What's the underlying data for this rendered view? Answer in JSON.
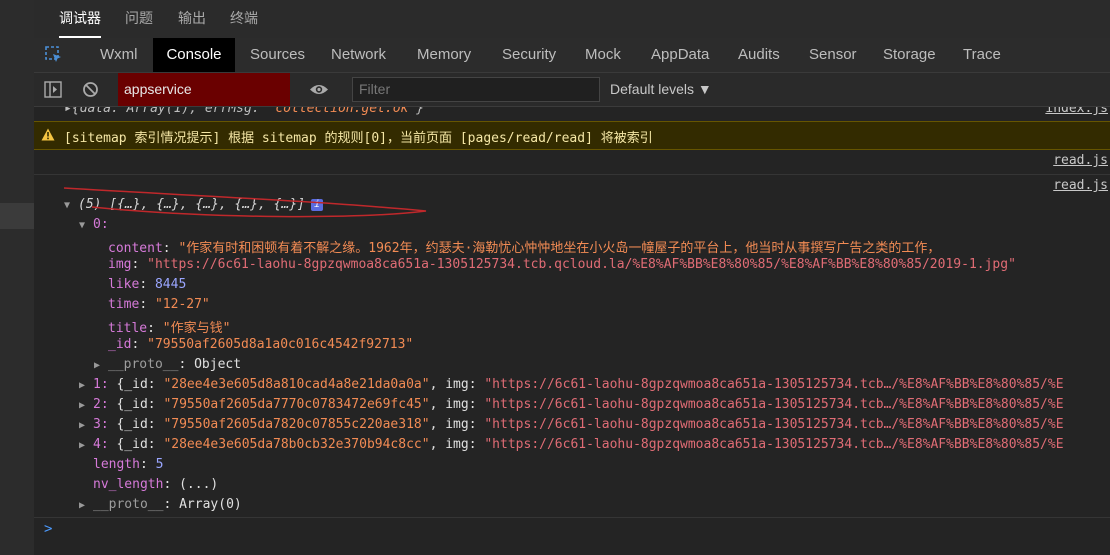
{
  "top_tabs": [
    {
      "label": "调试器",
      "active": true
    },
    {
      "label": "问题",
      "active": false
    },
    {
      "label": "输出",
      "active": false
    },
    {
      "label": "终端",
      "active": false
    }
  ],
  "devtools_tabs": [
    {
      "label": "Wxml"
    },
    {
      "label": "Console"
    },
    {
      "label": "Sources"
    },
    {
      "label": "Network"
    },
    {
      "label": "Memory"
    },
    {
      "label": "Security"
    },
    {
      "label": "Mock"
    },
    {
      "label": "AppData"
    },
    {
      "label": "Audits"
    },
    {
      "label": "Sensor"
    },
    {
      "label": "Storage"
    },
    {
      "label": "Trace"
    }
  ],
  "active_devtools_tab": "Console",
  "toolbar": {
    "context": "appservice",
    "filter_placeholder": "Filter",
    "levels": "Default levels ▼"
  },
  "console": {
    "prev_line": {
      "prefix": "▸{data: Array(1), errMsg: ",
      "value": "\"collection.get:ok\"",
      "suffix": "}",
      "source": "index.js"
    },
    "warning": {
      "text": "[sitemap 索引情况提示] 根据 sitemap 的规则[0]，当前页面 [pages/read/read] 将被索引"
    },
    "source_1": "read.js",
    "source_2": "read.js",
    "array_summary": "(5) [{…}, {…}, {…}, {…}, {…}]",
    "badge": "i",
    "item0": {
      "index": "0:",
      "content_key": "content",
      "content_val": "\"作家有时和困顿有着不解之缘。1962年，约瑟夫·海勒忧心忡忡地坐在小火岛一幢屋子的平台上，他当时从事撰写广告之类的工作，",
      "img_key": "img",
      "img_val": "\"https://6c61-laohu-8gpzqwmoa8ca651a-1305125734.tcb.qcloud.la/%E8%AF%BB%E8%80%85/%E8%AF%BB%E8%80%85/2019-1.jpg\"",
      "like_key": "like",
      "like_val": "8445",
      "time_key": "time",
      "time_val": "\"12-27\"",
      "title_key": "title",
      "title_val": "\"作家与钱\"",
      "id_key": "_id",
      "id_val": "\"79550af2605d8a1a0c016c4542f92713\"",
      "proto_key": "__proto__",
      "proto_val": "Object"
    },
    "items": [
      {
        "index": "1:",
        "id": "\"28ee4e3e605d8a810cad4a8e21da0a0a\"",
        "img": "\"https://6c61-laohu-8gpzqwmoa8ca651a-1305125734.tcb…/%E8%AF%BB%E8%80%85/%E"
      },
      {
        "index": "2:",
        "id": "\"79550af2605da7770c0783472e69fc45\"",
        "img": "\"https://6c61-laohu-8gpzqwmoa8ca651a-1305125734.tcb…/%E8%AF%BB%E8%80%85/%E"
      },
      {
        "index": "3:",
        "id": "\"79550af2605da7820c07855c220ae318\"",
        "img": "\"https://6c61-laohu-8gpzqwmoa8ca651a-1305125734.tcb…/%E8%AF%BB%E8%80%85/%E"
      },
      {
        "index": "4:",
        "id": "\"28ee4e3e605da78b0cb32e370b94c8cc\"",
        "img": "\"https://6c61-laohu-8gpzqwmoa8ca651a-1305125734.tcb…/%E8%AF%BB%E8%80%85/%E"
      }
    ],
    "item_id_key": "{_id",
    "item_img_key": "img",
    "length_key": "length",
    "length_val": "5",
    "nv_length_key": "nv_length",
    "nv_length_val": "(...)",
    "array_proto_key": "__proto__",
    "array_proto_val": "Array(0)",
    "prompt": ">"
  },
  "colors": {
    "context_bg": "#6a0000",
    "warning_bg": "#332b00",
    "annotation": "#c0282b"
  }
}
